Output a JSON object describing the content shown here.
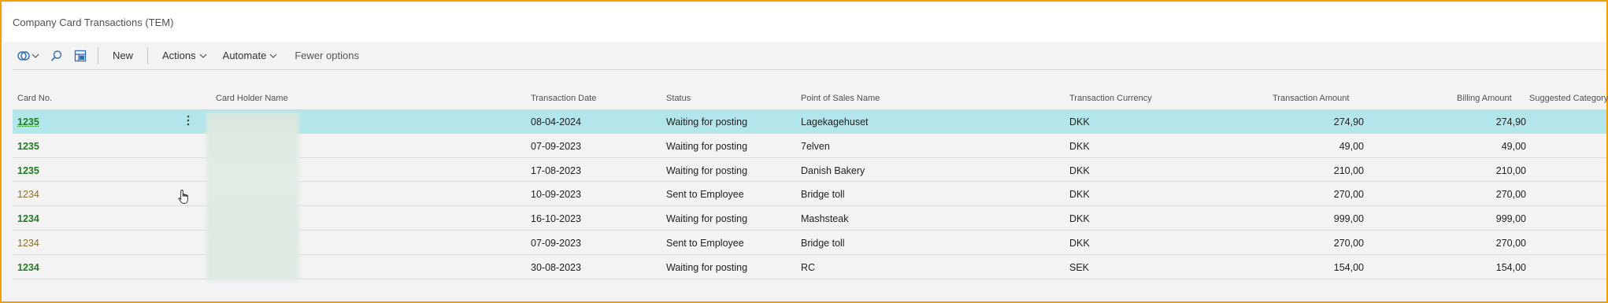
{
  "page": {
    "title": "Company Card Transactions (TEM)"
  },
  "toolbar": {
    "new_label": "New",
    "actions_label": "Actions",
    "automate_label": "Automate",
    "fewer_options_label": "Fewer options",
    "icons": [
      "copilot-icon",
      "chevron-down-icon",
      "search-icon",
      "layout-icon"
    ]
  },
  "columns": {
    "card_no": "Card No.",
    "card_holder_name": "Card Holder Name",
    "transaction_date": "Transaction Date",
    "status": "Status",
    "point_of_sales_name": "Point of Sales Name",
    "transaction_currency": "Transaction Currency",
    "transaction_amount": "Transaction Amount",
    "billing_amount": "Billing Amount",
    "suggested_category": "Suggested Category"
  },
  "rows": [
    {
      "card_no": "1235",
      "date": "08-04-2024",
      "status": "Waiting for posting",
      "pos": "Lagekagehuset",
      "currency": "DKK",
      "amount": "274,90",
      "billing": "274,90"
    },
    {
      "card_no": "1235",
      "date": "07-09-2023",
      "status": "Waiting for posting",
      "pos": "7elven",
      "currency": "DKK",
      "amount": "49,00",
      "billing": "49,00"
    },
    {
      "card_no": "1235",
      "date": "17-08-2023",
      "status": "Waiting for posting",
      "pos": "Danish Bakery",
      "currency": "DKK",
      "amount": "210,00",
      "billing": "210,00"
    },
    {
      "card_no": "1234",
      "date": "10-09-2023",
      "status": "Sent to Employee",
      "pos": "Bridge toll",
      "currency": "DKK",
      "amount": "270,00",
      "billing": "270,00"
    },
    {
      "card_no": "1234",
      "date": "16-10-2023",
      "status": "Waiting for posting",
      "pos": "Mashsteak",
      "currency": "DKK",
      "amount": "999,00",
      "billing": "999,00"
    },
    {
      "card_no": "1234",
      "date": "07-09-2023",
      "status": "Sent to Employee",
      "pos": "Bridge toll",
      "currency": "DKK",
      "amount": "270,00",
      "billing": "270,00"
    },
    {
      "card_no": "1234",
      "date": "30-08-2023",
      "status": "Waiting for posting",
      "pos": "RC",
      "currency": "SEK",
      "amount": "154,00",
      "billing": "154,00"
    }
  ],
  "colors": {
    "selected_row": "#b2e6ea",
    "card_link": "#1e7d1e",
    "frame": "#f0a000"
  }
}
